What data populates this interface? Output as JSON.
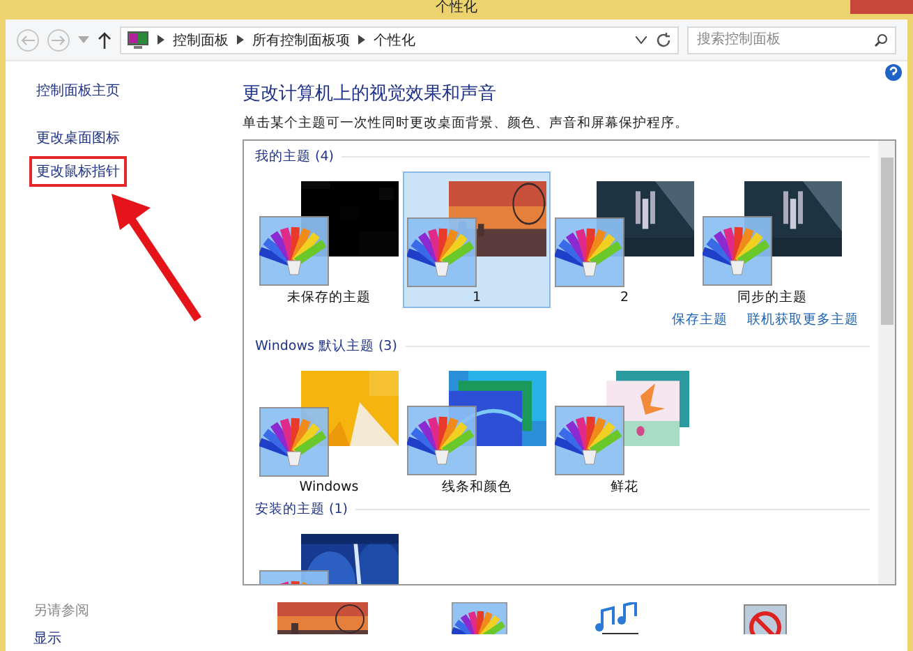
{
  "window": {
    "title": "个性化"
  },
  "address": {
    "crumbs": [
      "控制面板",
      "所有控制面板项",
      "个性化"
    ]
  },
  "search": {
    "placeholder": "搜索控制面板"
  },
  "sidebar": {
    "links": [
      {
        "label": "控制面板主页",
        "highlighted": false
      },
      {
        "label": "更改桌面图标",
        "highlighted": false
      },
      {
        "label": "更改鼠标指针",
        "highlighted": true
      }
    ],
    "see_also_heading": "另请参阅",
    "see_also": [
      "显示"
    ]
  },
  "main": {
    "heading": "更改计算机上的视觉效果和声音",
    "description": "单击某个主题可一次性同时更改桌面背景、颜色、声音和屏幕保护程序。",
    "groups": [
      {
        "title": "我的主题 (4)",
        "themes": [
          {
            "label": "未保存的主题",
            "selected": false
          },
          {
            "label": "1",
            "selected": true
          },
          {
            "label": "2",
            "selected": false
          },
          {
            "label": "同步的主题",
            "selected": false
          }
        ],
        "links": [
          "保存主题",
          "联机获取更多主题"
        ]
      },
      {
        "title": "Windows 默认主题 (3)",
        "themes": [
          {
            "label": "Windows",
            "selected": false
          },
          {
            "label": "线条和颜色",
            "selected": false
          },
          {
            "label": "鲜花",
            "selected": false
          }
        ]
      },
      {
        "title": "安装的主题 (1)",
        "themes": [
          {
            "selected": false
          }
        ]
      }
    ]
  }
}
